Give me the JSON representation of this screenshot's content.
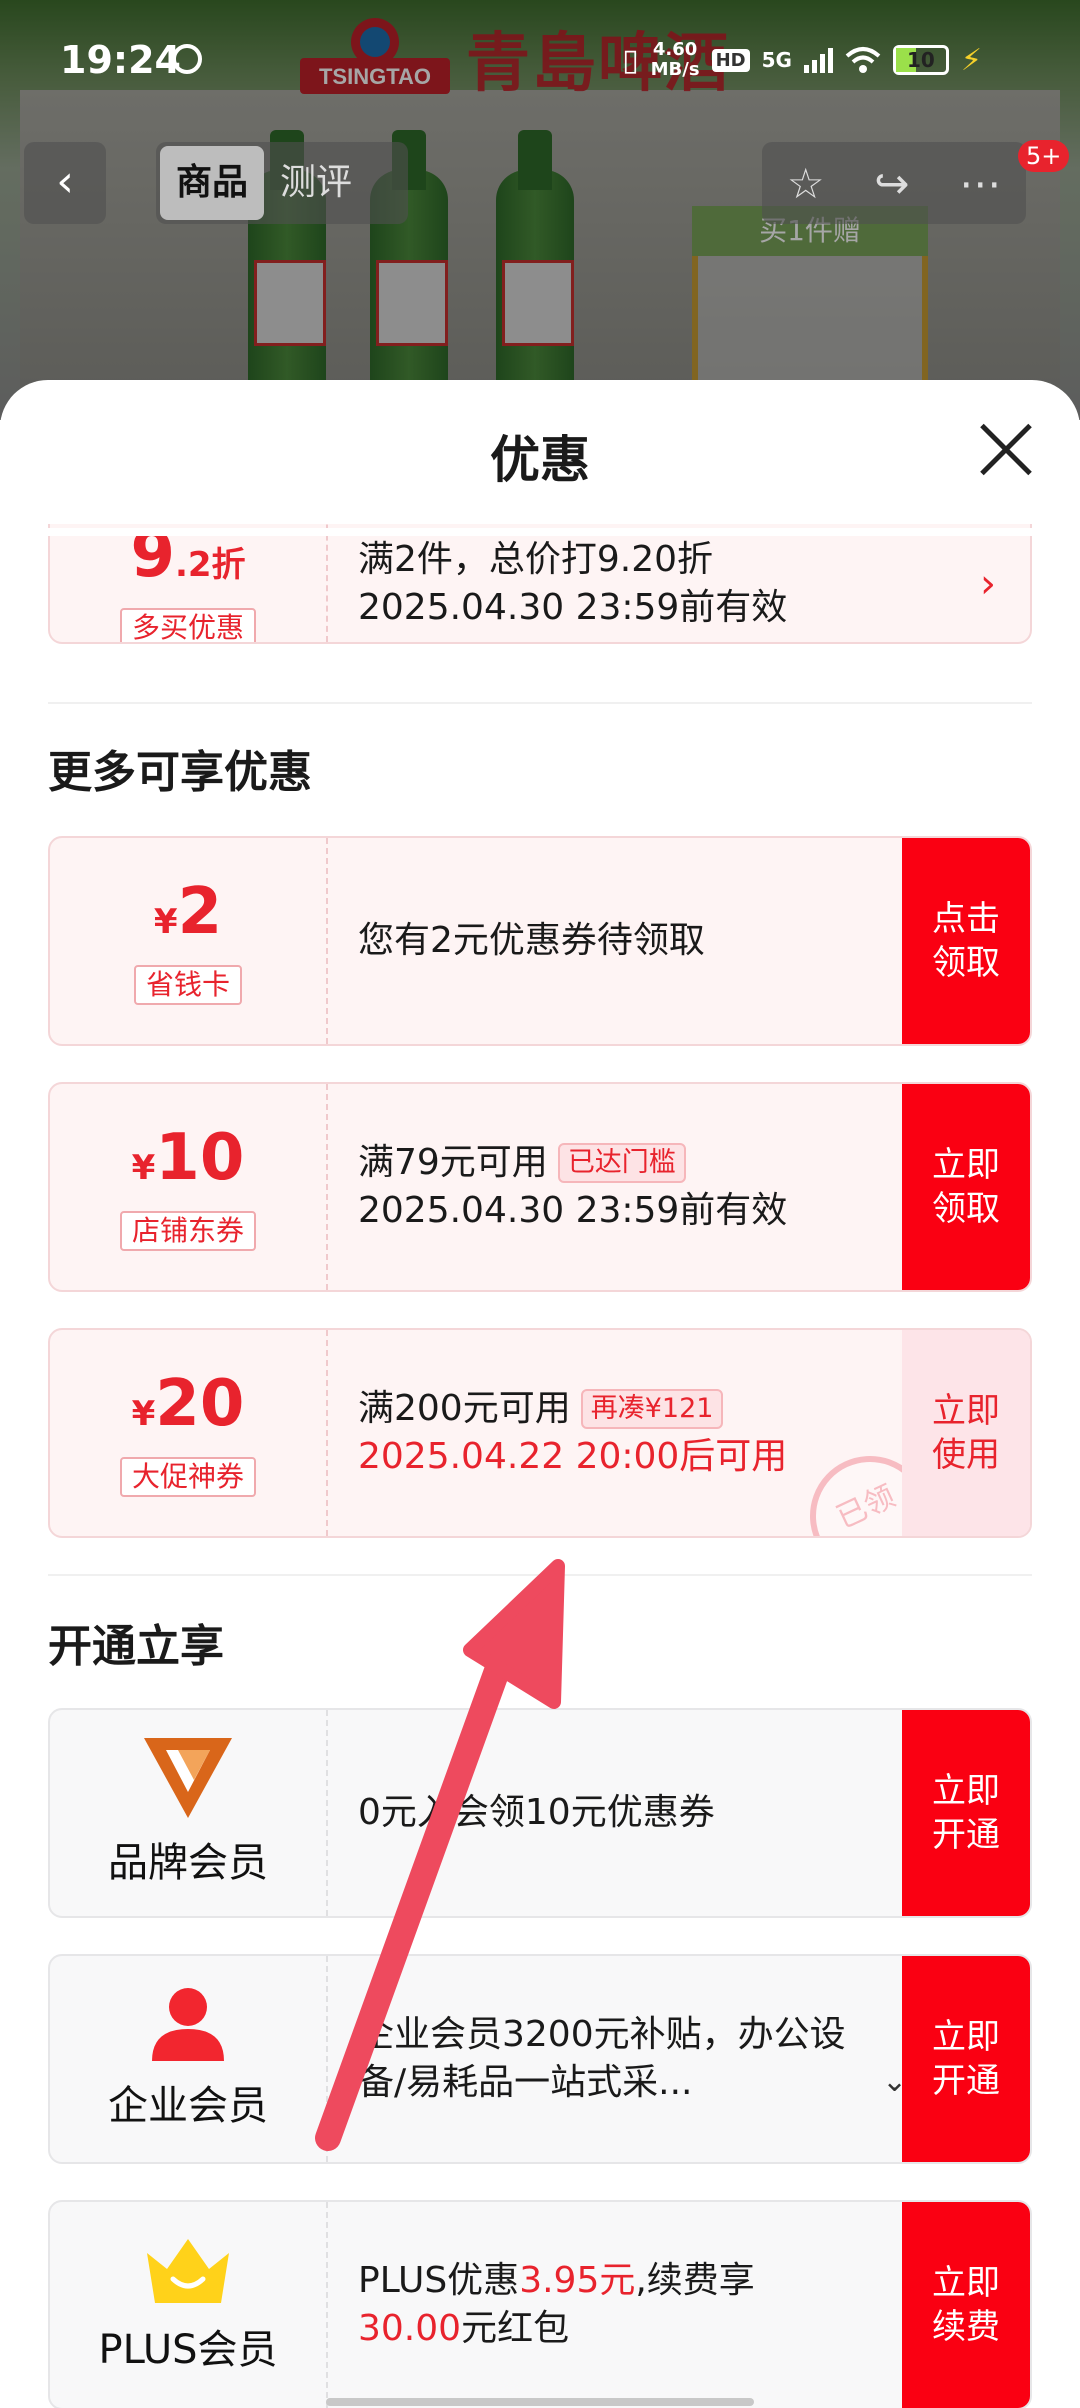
{
  "status_bar": {
    "time": "19:24",
    "speed_value": "4.60",
    "speed_unit": "MB/s",
    "hd": "HD",
    "network": "5G",
    "battery": "10"
  },
  "background": {
    "brand_logo_text": "TSINGTAO",
    "brand_cn": "青島啤酒",
    "gift_tag": "买1件赠"
  },
  "nav": {
    "back_icon": "back-chevron-icon",
    "tabs": [
      {
        "label": "商品",
        "active": true
      },
      {
        "label": "测评",
        "active": false
      }
    ],
    "actions": [
      "star-icon",
      "share-icon",
      "more-icon"
    ],
    "badge": "5+"
  },
  "sheet": {
    "title": "优惠",
    "close_icon": "close-icon",
    "top_card": {
      "amount_main": "9",
      "amount_decimal": ".2折",
      "tag": "多买优惠",
      "line1": "满2件，总价打9.20折",
      "line2": "2025.04.30 23:59前有效"
    },
    "more_section_title": "更多可享优惠",
    "coupons": [
      {
        "currency": "¥",
        "amount": "2",
        "tag": "省钱卡",
        "line1": "您有2元优惠券待领取",
        "badge": "",
        "line2": "",
        "action": "点击领取"
      },
      {
        "currency": "¥",
        "amount": "10",
        "tag": "店铺东券",
        "line1": "满79元可用",
        "badge": "已达门槛",
        "line2": "2025.04.30 23:59前有效",
        "action": "立即领取"
      },
      {
        "currency": "¥",
        "amount": "20",
        "tag": "大促神券",
        "line1": "满200元可用",
        "badge": "再凑¥121",
        "line2": "2025.04.22 20:00后可用",
        "action": "立即使用",
        "stamp": "已领"
      }
    ],
    "member_section_title": "开通立享",
    "members": [
      {
        "icon": "brand-v-icon",
        "name": "品牌会员",
        "text": "0元入会领10元优惠券",
        "action": "立即开通"
      },
      {
        "icon": "enterprise-person-icon",
        "name": "企业会员",
        "text": "企业会员3200元补贴，办公设备/易耗品一站式采...",
        "action": "立即开通"
      },
      {
        "icon": "plus-crown-icon",
        "name": "PLUS会员",
        "text_a": "PLUS优惠",
        "text_b": "3.95元",
        "text_c": ",续费享",
        "text_d": "30.00",
        "text_e": "元红包",
        "action": "立即续费"
      }
    ]
  },
  "colors": {
    "accent_red": "#fa0012",
    "price_red": "#e8232d",
    "arrow": "#ee4a5e"
  }
}
